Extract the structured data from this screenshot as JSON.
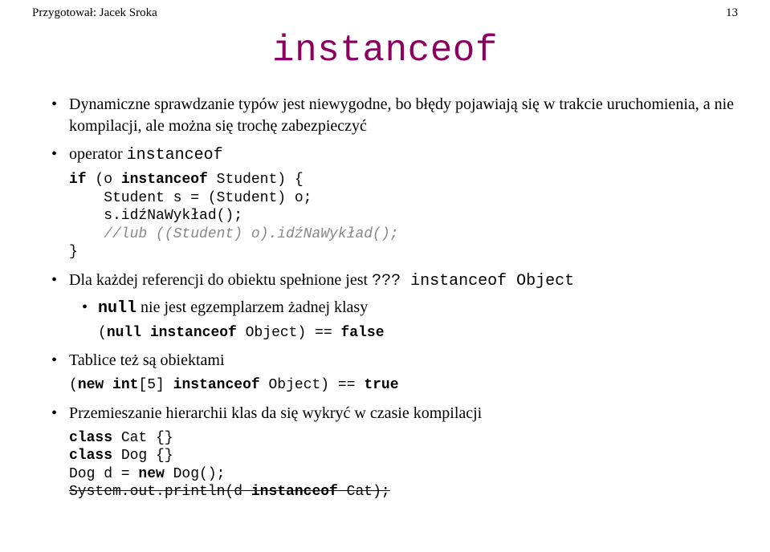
{
  "header": {
    "author": "Przygotował: Jacek Sroka",
    "page_number": "13"
  },
  "title": "instanceof",
  "bullets": {
    "b1": "Dynamiczne sprawdzanie typów jest niewygodne, bo błędy pojawiają się w trakcie uruchomienia, a nie kompilacji, ale można się trochę zabezpieczyć",
    "b2_prefix": "operator ",
    "b2_code": "instanceof",
    "b3_prefix": "Dla każdej referencji do obiektu spełnione jest ",
    "b3_code": "??? instanceof Object",
    "b3_sub_prefix_code": "null",
    "b3_sub_text": " nie jest egzemplarzem żadnej klasy",
    "b4": "Tablice też są obiektami",
    "b5": "Przemieszanie hierarchii klas da się wykryć w czasie kompilacji"
  },
  "code": {
    "c1_kw_if": "if",
    "c1_rest": " (o ",
    "c1_kw_instanceof": "instanceof",
    "c1_rest2": " Student) {",
    "c2": "    Student s = (Student) o;",
    "c3": "    s.idźNaWykład();",
    "c4_comment": "    //lub ((Student) o).idźNaWykład();",
    "c5": "}",
    "null_check_open": "(",
    "null_check_kw": "null",
    "null_check_mid": " ",
    "null_check_instanceof": "instanceof",
    "null_check_rest": " Object) == ",
    "null_check_false": "false",
    "array_check_open": "(",
    "array_check_kw": "new",
    "array_check_mid": " ",
    "array_check_kw2": "int",
    "array_check_arr": "[5] ",
    "array_check_instanceof": "instanceof",
    "array_check_rest": " Object) == ",
    "array_check_true": "true",
    "cat_kw": "class",
    "cat_rest": " Cat {}",
    "dog_kw": "class",
    "dog_rest": " Dog {}",
    "dogdecl_pre": "Dog d = ",
    "dogdecl_kw": "new",
    "dogdecl_post": " Dog();",
    "sysout": "System.out.println(d ",
    "sysout_kw": "instanceof",
    "sysout_post": " Cat);"
  }
}
